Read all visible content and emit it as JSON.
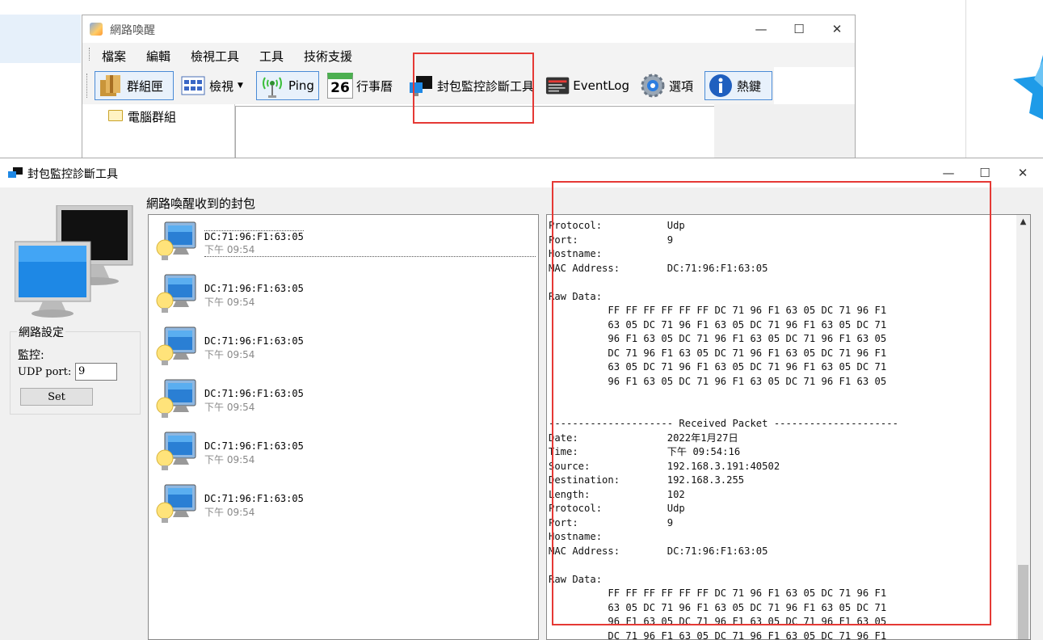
{
  "main_window": {
    "title": "網路喚醒",
    "controls": {
      "minimize": "—",
      "maximize": "☐",
      "close": "✕"
    },
    "menu": [
      "檔案",
      "編輯",
      "檢視工具",
      "工具",
      "技術支援"
    ],
    "toolbar": {
      "group": "群組匣",
      "view": "檢視",
      "ping": "Ping",
      "calendar_day": "26",
      "schedule": "行事曆",
      "packet_tool": "封包監控診斷工具",
      "eventlog": "EventLog",
      "options": "選項",
      "hotkey": "熱鍵"
    },
    "tree": {
      "root": "電腦群組"
    }
  },
  "packet_window": {
    "title": "封包監控診斷工具",
    "controls": {
      "minimize": "—",
      "maximize": "☐",
      "close": "✕"
    },
    "net_settings": {
      "legend": "網路設定",
      "monitor_label": "監控:",
      "udp_port_label": "UDP port:",
      "udp_port_value": "9",
      "set_button": "Set"
    },
    "list_heading": "網路喚醒收到的封包",
    "packets": [
      {
        "mac": "DC:71:96:F1:63:05",
        "time": "下午 09:54"
      },
      {
        "mac": "DC:71:96:F1:63:05",
        "time": "下午 09:54"
      },
      {
        "mac": "DC:71:96:F1:63:05",
        "time": "下午 09:54"
      },
      {
        "mac": "DC:71:96:F1:63:05",
        "time": "下午 09:54"
      },
      {
        "mac": "DC:71:96:F1:63:05",
        "time": "下午 09:54"
      },
      {
        "mac": "DC:71:96:F1:63:05",
        "time": "下午 09:54"
      }
    ],
    "detail_text": "Protocol:           Udp\nPort:               9\nHostname:\nMAC Address:        DC:71:96:F1:63:05\n\nRaw Data:\n          FF FF FF FF FF FF DC 71 96 F1 63 05 DC 71 96 F1\n          63 05 DC 71 96 F1 63 05 DC 71 96 F1 63 05 DC 71\n          96 F1 63 05 DC 71 96 F1 63 05 DC 71 96 F1 63 05\n          DC 71 96 F1 63 05 DC 71 96 F1 63 05 DC 71 96 F1\n          63 05 DC 71 96 F1 63 05 DC 71 96 F1 63 05 DC 71\n          96 F1 63 05 DC 71 96 F1 63 05 DC 71 96 F1 63 05\n\n\n--------------------- Received Packet ---------------------\nDate:               2022年1月27日\nTime:               下午 09:54:16\nSource:             192.168.3.191:40502\nDestination:        192.168.3.255\nLength:             102\nProtocol:           Udp\nPort:               9\nHostname:\nMAC Address:        DC:71:96:F1:63:05\n\nRaw Data:\n          FF FF FF FF FF FF DC 71 96 F1 63 05 DC 71 96 F1\n          63 05 DC 71 96 F1 63 05 DC 71 96 F1 63 05 DC 71\n          96 F1 63 05 DC 71 96 F1 63 05 DC 71 96 F1 63 05\n          DC 71 96 F1 63 05 DC 71 96 F1 63 05 DC 71 96 F1"
  },
  "colors": {
    "highlight": "#e53935",
    "accent": "#4a8bd6",
    "window_bg": "#f0f0f0"
  },
  "icons": [
    "app-icon",
    "group-box-icon",
    "view-grid-icon",
    "ping-antenna-icon",
    "calendar-icon",
    "packet-monitor-icon",
    "eventlog-icon",
    "options-gear-icon",
    "info-icon",
    "folder-icon",
    "computers-icon",
    "bulb-monitor-icon",
    "star-icon"
  ]
}
